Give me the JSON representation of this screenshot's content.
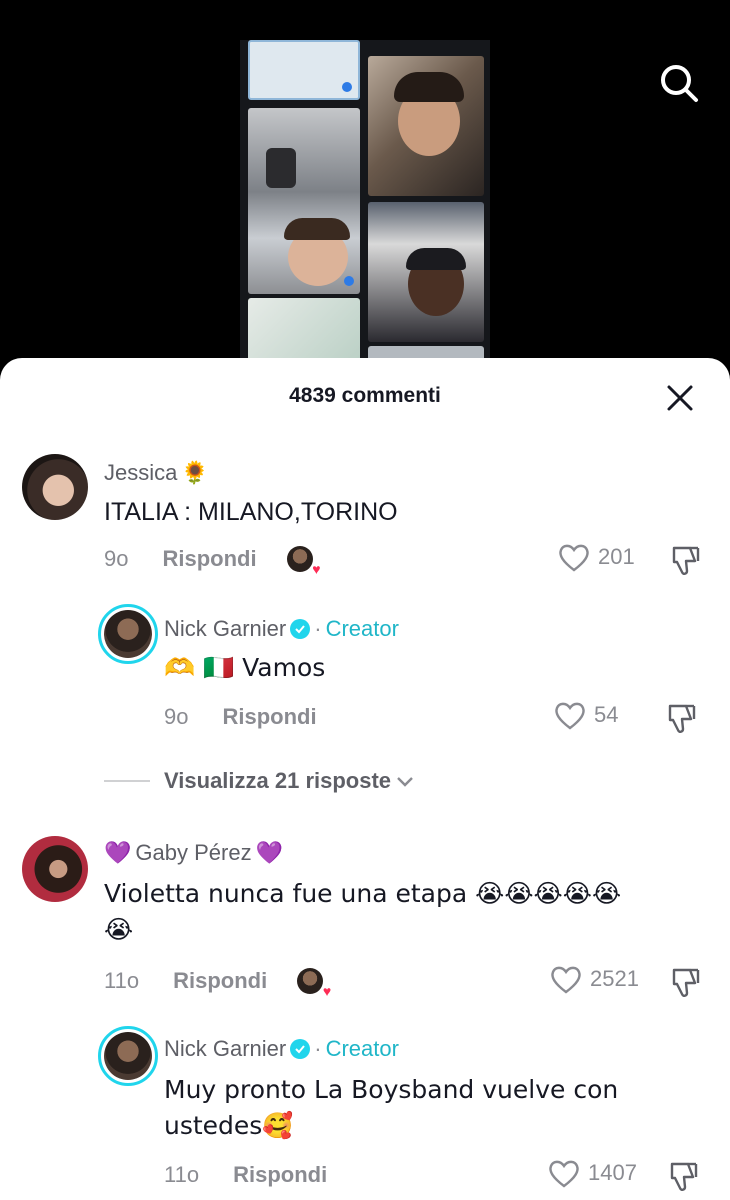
{
  "header": {
    "comment_count_label": "4839 commenti"
  },
  "comments": [
    {
      "username": "Jessica",
      "username_emoji": "🌻",
      "text": "ITALIA : MILANO,TORINO",
      "time": "9o",
      "reply_label": "Rispondi",
      "likes": "201",
      "creator_liked": true
    },
    {
      "username": "Nick Garnier",
      "creator_label": "Creator",
      "text": "🫶 🇮🇹 Vamos",
      "time": "9o",
      "reply_label": "Rispondi",
      "likes": "54"
    },
    {
      "username": "Gaby Pérez",
      "username_emoji_left": "💜",
      "username_emoji_right": "💜",
      "text_line1": "Violetta nunca fue una etapa 😭😭😭😭😭",
      "text_line2": "😭",
      "time": "11o",
      "reply_label": "Rispondi",
      "likes": "2521",
      "creator_liked": true
    },
    {
      "username": "Nick Garnier",
      "creator_label": "Creator",
      "text_line1": "Muy pronto La Boysband vuelve con",
      "text_line2": "ustedes🥰",
      "time": "11o",
      "reply_label": "Rispondi",
      "likes": "1407"
    }
  ],
  "view_replies_label": "Visualizza 21 risposte",
  "colors": {
    "creator_accent": "#20d5ec",
    "text_primary": "#161823",
    "text_secondary": "#8a8b91",
    "heart": "#fe2c55"
  },
  "icons": [
    "search-icon",
    "close-icon",
    "heart-outline-icon",
    "thumbs-down-icon",
    "verified-icon",
    "chevron-down-icon"
  ]
}
